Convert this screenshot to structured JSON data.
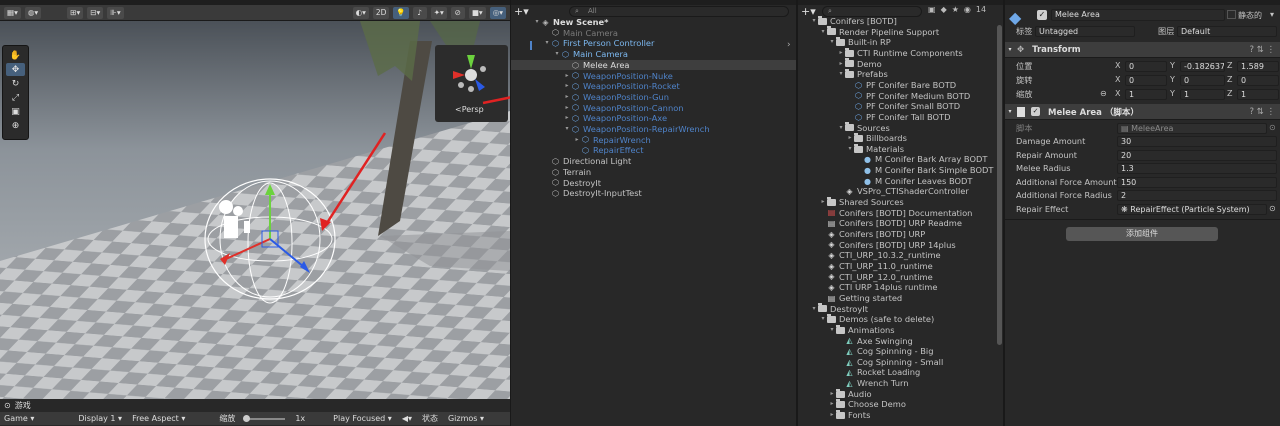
{
  "scene": {
    "toolbar": {
      "mode_2d": "2D"
    },
    "gizmo_label": "<Persp",
    "bottom_tab": "游戏",
    "game_bar": {
      "view": "Game",
      "display": "Display 1",
      "aspect": "Free Aspect",
      "scale_label": "缩放",
      "scale_value": "1x",
      "play_mode": "Play Focused",
      "stats": "状态",
      "gizmos": "Gizmos"
    }
  },
  "hierarchy": {
    "search_placeholder": "All",
    "items": [
      {
        "label": "New Scene*",
        "kind": "scene"
      },
      {
        "label": "Main Camera",
        "kind": "dim"
      },
      {
        "label": "First Person Controller",
        "kind": "prefab"
      },
      {
        "label": "Main Camera",
        "kind": "prefab"
      },
      {
        "label": "Melee Area",
        "kind": "selected"
      },
      {
        "label": "WeaponPosition-Nuke",
        "kind": "blue"
      },
      {
        "label": "WeaponPosition-Rocket",
        "kind": "blue"
      },
      {
        "label": "WeaponPosition-Gun",
        "kind": "blue"
      },
      {
        "label": "WeaponPosition-Cannon",
        "kind": "blue"
      },
      {
        "label": "WeaponPosition-Axe",
        "kind": "blue"
      },
      {
        "label": "WeaponPosition-RepairWrench",
        "kind": "blue"
      },
      {
        "label": "RepairWrench",
        "kind": "blue"
      },
      {
        "label": "RepairEffect",
        "kind": "blue"
      },
      {
        "label": "Directional Light",
        "kind": "normal"
      },
      {
        "label": "Terrain",
        "kind": "normal"
      },
      {
        "label": "DestroyIt",
        "kind": "normal"
      },
      {
        "label": "DestroyIt-InputTest",
        "kind": "normal"
      }
    ]
  },
  "project": {
    "count_badge": "14",
    "items": [
      {
        "label": "Conifers [BOTD]",
        "type": "folder"
      },
      {
        "label": "Render Pipeline Support",
        "type": "folder"
      },
      {
        "label": "Built-in RP",
        "type": "folder"
      },
      {
        "label": "CTI Runtime Components",
        "type": "folder"
      },
      {
        "label": "Demo",
        "type": "folder"
      },
      {
        "label": "Prefabs",
        "type": "folder"
      },
      {
        "label": "PF Conifer Bare BOTD",
        "type": "prefab"
      },
      {
        "label": "PF Conifer Medium BOTD",
        "type": "prefab"
      },
      {
        "label": "PF Conifer Small BOTD",
        "type": "prefab"
      },
      {
        "label": "PF Conifer Tall BOTD",
        "type": "prefab"
      },
      {
        "label": "Sources",
        "type": "folder"
      },
      {
        "label": "Billboards",
        "type": "folder"
      },
      {
        "label": "Materials",
        "type": "folder"
      },
      {
        "label": "M Conifer Bark Array BODT",
        "type": "material"
      },
      {
        "label": "M Conifer Bark Simple BODT",
        "type": "material"
      },
      {
        "label": "M Conifer Leaves BODT",
        "type": "material"
      },
      {
        "label": "VSPro_CTIShaderController",
        "type": "unity"
      },
      {
        "label": "Shared Sources",
        "type": "folder"
      },
      {
        "label": "Conifers [BOTD] Documentation",
        "type": "pdf"
      },
      {
        "label": "Conifers [BOTD] URP Readme",
        "type": "doc"
      },
      {
        "label": "Conifers [BOTD] URP",
        "type": "unity"
      },
      {
        "label": "Conifers [BOTD] URP 14plus",
        "type": "unity"
      },
      {
        "label": "CTI_URP_10.3.2_runtime",
        "type": "unity"
      },
      {
        "label": "CTI_URP_11.0_runtime",
        "type": "unity"
      },
      {
        "label": "CTI_URP_12.0_runtime",
        "type": "unity"
      },
      {
        "label": "CTI URP 14plus runtime",
        "type": "unity"
      },
      {
        "label": "Getting started",
        "type": "doc"
      },
      {
        "label": "DestroyIt",
        "type": "folder"
      },
      {
        "label": "Demos (safe to delete)",
        "type": "folder"
      },
      {
        "label": "Animations",
        "type": "folder"
      },
      {
        "label": "Axe Swinging",
        "type": "anim"
      },
      {
        "label": "Cog Spinning - Big",
        "type": "anim"
      },
      {
        "label": "Cog Spinning - Small",
        "type": "anim"
      },
      {
        "label": "Rocket Loading",
        "type": "anim"
      },
      {
        "label": "Wrench Turn",
        "type": "anim"
      },
      {
        "label": "Audio",
        "type": "folder"
      },
      {
        "label": "Choose Demo",
        "type": "folder"
      },
      {
        "label": "Fonts",
        "type": "folder"
      }
    ]
  },
  "inspector": {
    "object_name": "Melee Area",
    "static_label": "静态的",
    "tag_label": "标签",
    "tag_value": "Untagged",
    "layer_label": "图层",
    "layer_value": "Default",
    "transform": {
      "title": "Transform",
      "position_label": "位置",
      "rotation_label": "旋转",
      "scale_label": "缩放",
      "position": {
        "x": "0",
        "y": "-0.182637",
        "z": "1.589"
      },
      "rotation": {
        "x": "0",
        "y": "0",
        "z": "0"
      },
      "scale": {
        "x": "1",
        "y": "1",
        "z": "1"
      }
    },
    "script_component": {
      "title": "Melee Area （脚本）",
      "script_label": "脚本",
      "script_value": "MeleeArea",
      "fields": [
        {
          "label": "Damage Amount",
          "value": "30"
        },
        {
          "label": "Repair Amount",
          "value": "20"
        },
        {
          "label": "Melee Radius",
          "value": "1.3"
        },
        {
          "label": "Additional Force Amount",
          "value": "150"
        },
        {
          "label": "Additional Force Radius",
          "value": "2"
        },
        {
          "label": "Repair Effect",
          "value": "RepairEffect (Particle System)"
        }
      ]
    },
    "add_component": "添加组件"
  }
}
